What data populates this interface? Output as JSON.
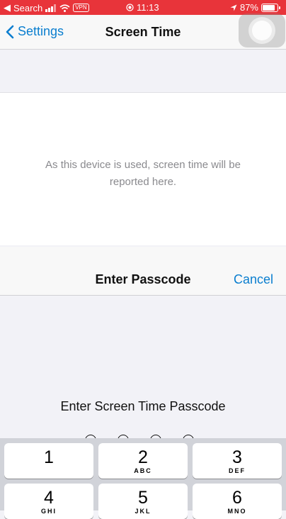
{
  "status_bar": {
    "carrier": "Search",
    "vpn": "VPN",
    "time": "11:13",
    "battery": "87%"
  },
  "nav": {
    "back_label": "Settings",
    "title": "Screen Time"
  },
  "card": {
    "message": "As this device is used, screen time will be reported here."
  },
  "modal": {
    "title": "Enter Passcode",
    "cancel_label": "Cancel",
    "prompt": "Enter Screen Time Passcode"
  },
  "keypad": {
    "keys": [
      {
        "num": "1",
        "letters": ""
      },
      {
        "num": "2",
        "letters": "ABC"
      },
      {
        "num": "3",
        "letters": "DEF"
      },
      {
        "num": "4",
        "letters": "GHI"
      },
      {
        "num": "5",
        "letters": "JKL"
      },
      {
        "num": "6",
        "letters": "MNO"
      }
    ]
  },
  "colors": {
    "status_bar": "#e8343a",
    "accent": "#0a7ecf"
  }
}
